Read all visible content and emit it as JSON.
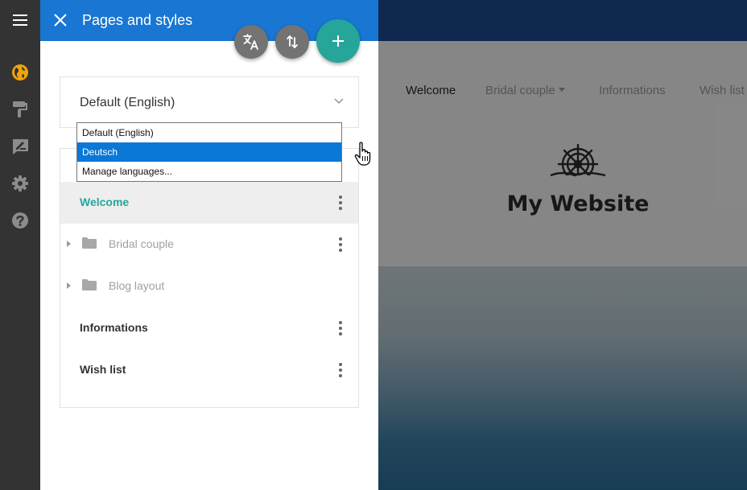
{
  "rail": {
    "items": [
      {
        "icon": "menu-icon"
      },
      {
        "icon": "globe-icon",
        "active_color": "#f0a30a"
      },
      {
        "icon": "paint-roller-icon"
      },
      {
        "icon": "edit-note-icon"
      },
      {
        "icon": "gear-icon"
      },
      {
        "icon": "help-icon"
      }
    ]
  },
  "drawer": {
    "title": "Pages and styles",
    "actions": [
      {
        "icon": "translate-icon"
      },
      {
        "icon": "sort-arrows-icon"
      },
      {
        "icon": "plus-icon"
      }
    ],
    "language_select": {
      "value": "Default (English)",
      "options": [
        "Default (English)",
        "Deutsch",
        "Manage languages..."
      ],
      "highlighted": "Deutsch"
    },
    "pages": [
      {
        "label": "Welcome",
        "active": true
      },
      {
        "label": "Bridal couple",
        "folder": true
      },
      {
        "label": "Blog layout",
        "folder": true
      },
      {
        "label": "Informations"
      },
      {
        "label": "Wish list"
      }
    ]
  },
  "preview": {
    "nav": [
      "Welcome",
      "Bridal couple",
      "Informations",
      "Wish list"
    ],
    "site_title": "My Website"
  },
  "colors": {
    "header_blue": "#1976d2",
    "accent_teal": "#26a69a",
    "rail_bg": "#333333",
    "preview_topbar": "#1d4a93",
    "selection_blue": "#0a78d7"
  }
}
